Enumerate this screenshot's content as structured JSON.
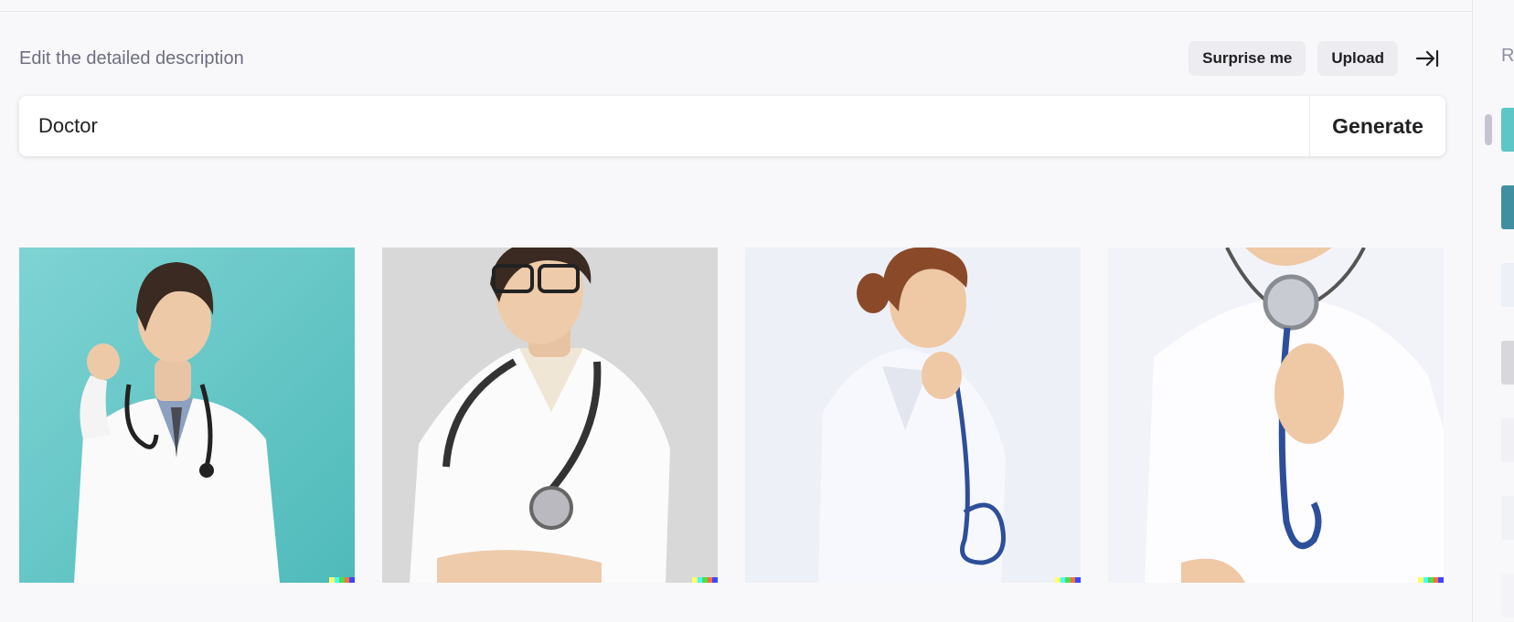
{
  "editor": {
    "heading": "Edit the detailed description",
    "surprise_label": "Surprise me",
    "upload_label": "Upload",
    "collapse_icon": "collapse-right-icon",
    "prompt_value": "Doctor",
    "generate_label": "Generate"
  },
  "results": [
    {
      "subject": "young male doctor in white coat with stethoscope, raised fist, teal background",
      "bg": "#5ec6c6"
    },
    {
      "subject": "smiling female doctor with glasses, white coat, stethoscope, grey background",
      "bg": "#d4d4d4"
    },
    {
      "subject": "female doctor in white coat holding stethoscope, looking down, light background",
      "bg": "#eef0f8"
    },
    {
      "subject": "close-up of doctor holding stethoscope chestpiece, white uniform",
      "bg": "#f2f3f8"
    }
  ],
  "sidebar": {
    "label": "R",
    "thumbs": [
      {
        "bg": "#5ec6c6"
      },
      {
        "bg": "#3f8fa0"
      },
      {
        "bg": "#eef0f8"
      },
      {
        "bg": "#d8d8dc"
      },
      {
        "bg": "#f1f1f5"
      },
      {
        "bg": "#f1f2f6"
      },
      {
        "bg": "#f4f4f8"
      }
    ]
  },
  "colors": {
    "page_bg": "#f8f8fa",
    "pill_bg": "#ececf1",
    "text_primary": "#202123",
    "text_muted": "#6e6e80",
    "watermark": [
      "#ffff66",
      "#42ffff",
      "#51da4c",
      "#ff6e3c",
      "#3c46ff"
    ]
  }
}
